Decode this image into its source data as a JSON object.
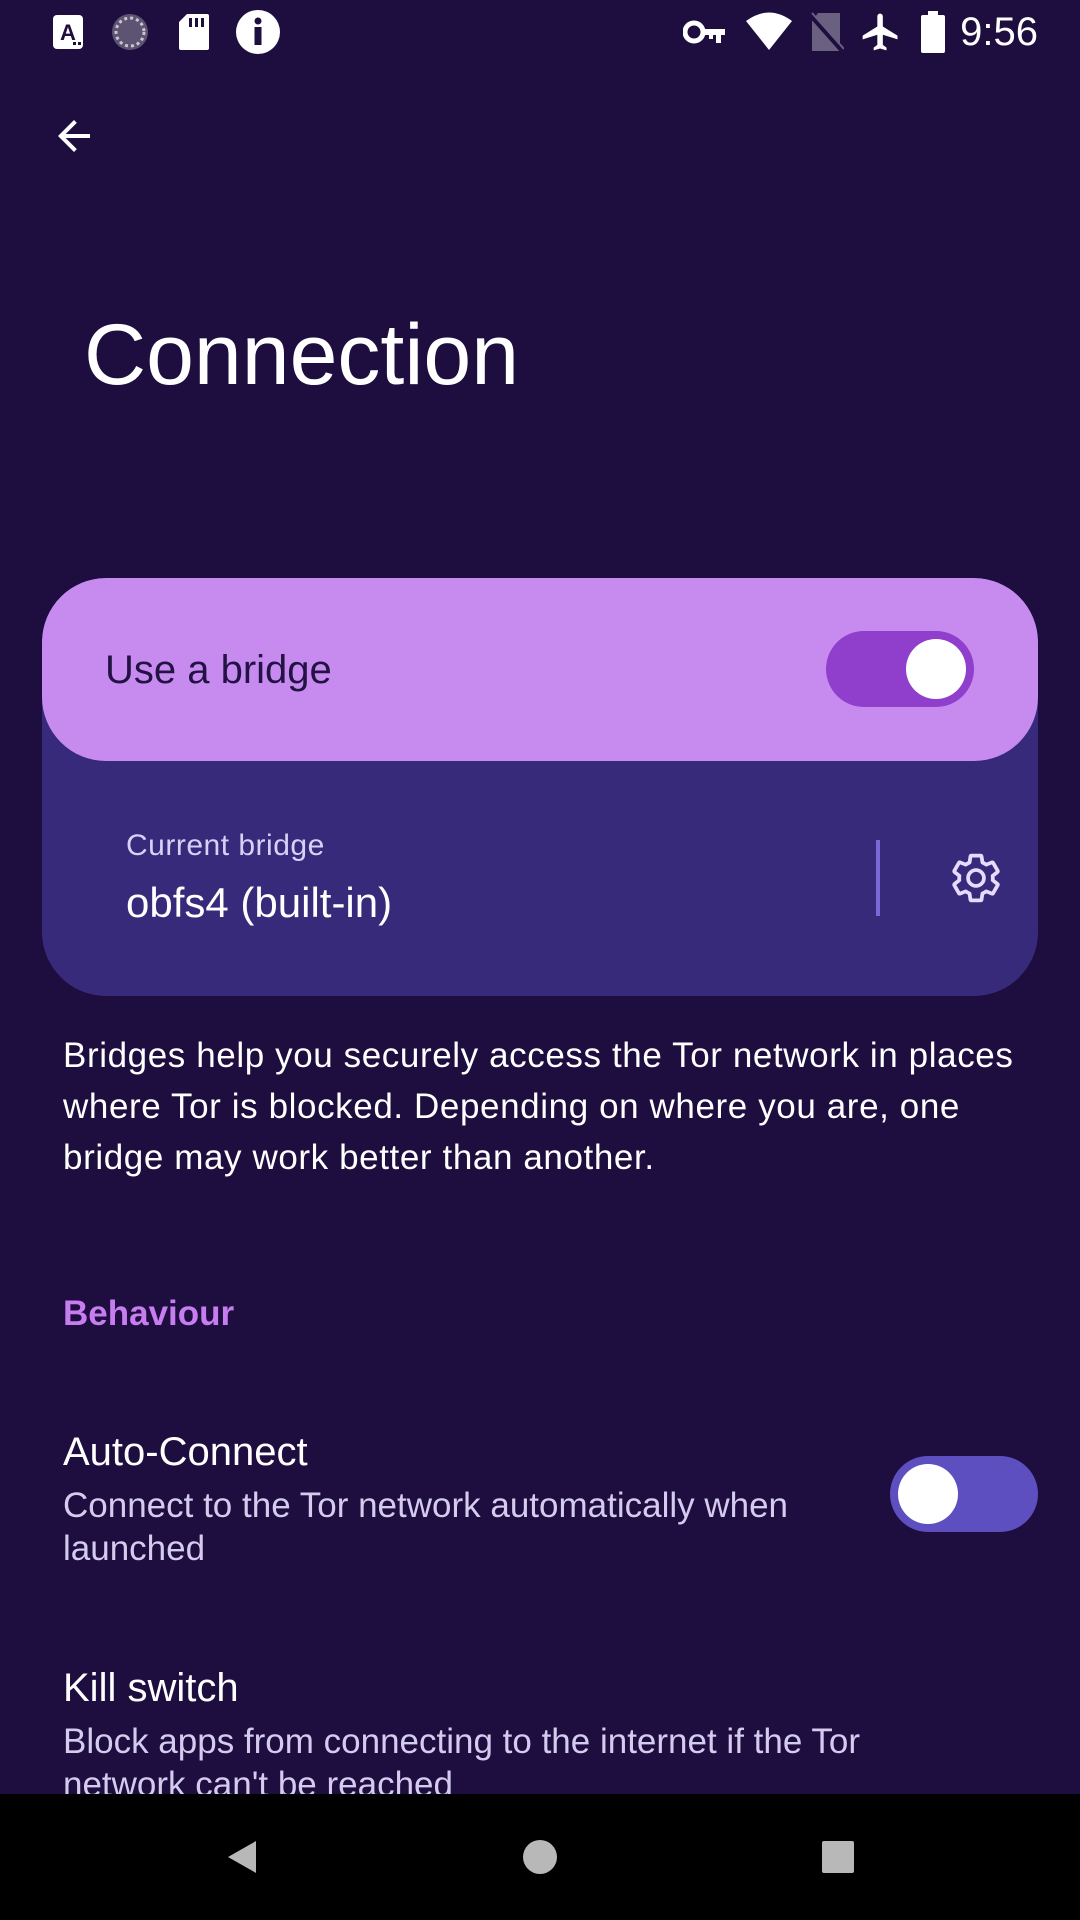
{
  "status_bar": {
    "time": "9:56",
    "left_icons": [
      "font-a-icon",
      "sync-circle-icon",
      "sd-card-icon",
      "info-icon"
    ],
    "right_icons": [
      "vpn-key-icon",
      "wifi-icon",
      "no-sim-icon",
      "airplane-mode-icon",
      "battery-icon"
    ]
  },
  "header": {
    "back_icon": "arrow-back-icon",
    "title": "Connection"
  },
  "bridge_card": {
    "toggle_label": "Use a bridge",
    "toggle_on": true,
    "current_bridge_caption": "Current bridge",
    "current_bridge_value": "obfs4 (built-in)",
    "settings_icon": "gear-icon"
  },
  "description": "Bridges help you securely access the Tor network in places where Tor is blocked. Depending on where you are, one bridge may work better than another.",
  "behaviour": {
    "section_title": "Behaviour",
    "items": [
      {
        "title": "Auto-Connect",
        "summary": "Connect to the Tor network automatically when launched",
        "toggle_on": false
      },
      {
        "title": "Kill switch",
        "summary": "Block apps from connecting to the internet if the Tor network can't be reached"
      }
    ]
  },
  "nav_bar": {
    "icons": [
      "back-triangle-icon",
      "home-circle-icon",
      "recents-square-icon"
    ]
  },
  "colors": {
    "background": "#1e0d3f",
    "card": "#382a7b",
    "card_highlight": "#c78bf0",
    "accent": "#c77df0",
    "switch_on_track": "#8f3fcc",
    "switch_off_track": "#5d4fc0"
  }
}
